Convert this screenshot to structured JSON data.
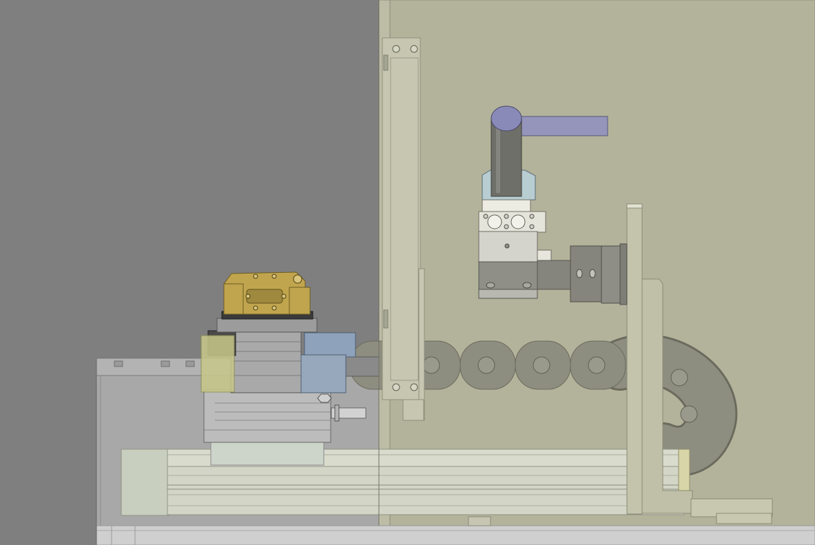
{
  "palette": {
    "viewport_bg": "#7f7f7f",
    "panel": "#b3b39b",
    "panel_edge": "#bdbda6",
    "base_box": "#a8a8a8",
    "base_plate": "#b3b3b3",
    "floor_strip": "#cfcfcf",
    "rail": "#d3d6c6",
    "rail_top": "#d9dccd",
    "rail_block": "#c9cfbe",
    "vertical_rail": "#c7c7b1",
    "gripper_gold": "#c1a54e",
    "gripper_slot": "#9f893f",
    "rotary_top": "#9c9c9c",
    "rotary_body": "#a9a9a9",
    "dark_block": "#4a4a4a",
    "yellow_block": "#c8c88a",
    "blue_block": "#8ea3bb",
    "blue_block_lower": "#97a8bc",
    "motor": "#bcbcbc",
    "motor_mount": "#cdd4c9",
    "shaft": "#d2d2d2",
    "cylinder_dark": "#6f6f69",
    "cylinder_top": "#8a8ab8",
    "arm": "#9595bb",
    "clamp_blue": "#b7cdd2",
    "valve_white": "#e4e4da",
    "valve_block": "#d4d4cc",
    "actuator_body": "#8f8f88",
    "actuator_plate": "#b8b8b0",
    "fitting": "#85857d",
    "flange": "#8e8e86",
    "chain": "#8e8e80",
    "chain_pin": "#9a9a8c",
    "bracket": "#c4c4ac",
    "bracket_l": "#c0c0a8",
    "bracket_base": "#c8c8b0"
  }
}
